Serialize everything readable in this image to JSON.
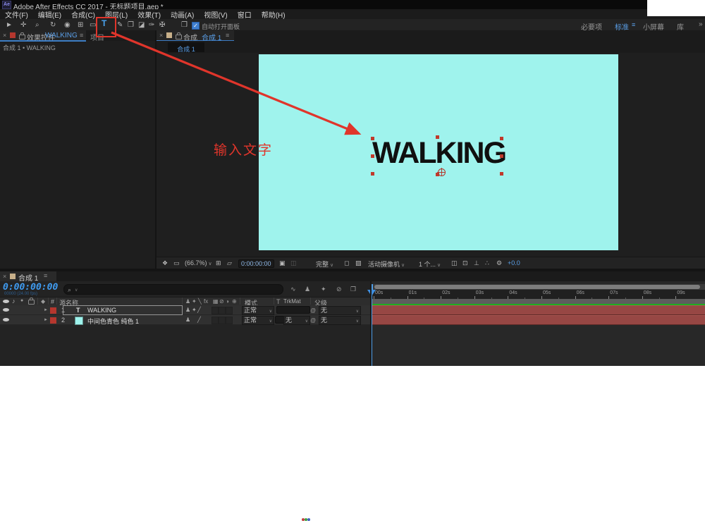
{
  "window": {
    "logo": "Ae",
    "title": "Adobe After Effects CC 2017 - 无标题项目.aep *"
  },
  "menu": {
    "items": [
      "文件(F)",
      "编辑(E)",
      "合成(C)",
      "图层(L)",
      "效果(T)",
      "动画(A)",
      "视图(V)",
      "窗口",
      "帮助(H)"
    ]
  },
  "toolbar": {
    "tools": [
      {
        "name": "selection-tool",
        "glyph": "►"
      },
      {
        "name": "hand-tool",
        "glyph": "✛"
      },
      {
        "name": "zoom-tool",
        "glyph": "⌕"
      },
      {
        "name": "rotation-tool",
        "glyph": "↻"
      },
      {
        "name": "camera-tool",
        "glyph": "◉"
      },
      {
        "name": "pan-behind-tool",
        "glyph": "⊞"
      },
      {
        "name": "shape-tool",
        "glyph": "▭"
      },
      {
        "name": "type-tool",
        "glyph": "T",
        "active": true
      },
      {
        "name": "brush-tool",
        "glyph": "✎"
      },
      {
        "name": "clone-stamp-tool",
        "glyph": "❐"
      },
      {
        "name": "eraser-tool",
        "glyph": "◪"
      },
      {
        "name": "roto-brush-tool",
        "glyph": "✑"
      },
      {
        "name": "puppet-pin-tool",
        "glyph": "✠"
      }
    ],
    "panel_button_icon": "❒",
    "auto_open_label": "自动打开面板",
    "workspaces": [
      {
        "label": "必要项",
        "active": false
      },
      {
        "label": "标准",
        "active": true
      },
      {
        "label": "小屏幕",
        "active": false
      },
      {
        "label": "库",
        "active": false
      }
    ],
    "overflow": "»"
  },
  "effect_controls_panel": {
    "tab_title": "效果控件",
    "tab_target": "WALKING",
    "neighbor_tab": "项目",
    "subtitle": "合成 1 • WALKING"
  },
  "comp_panel": {
    "tab_title": "合成",
    "tab_target": "合成 1",
    "viewer_tab": "合成 1",
    "canvas_text": "WALKING",
    "canvas_color": "#9ff3ed",
    "statusbar": {
      "zoom": "(66.7%)",
      "timecode": "0:00:00:00",
      "resolution": "完整",
      "camera": "活动摄像机",
      "views": "1 个...",
      "exposure": "+0.0"
    }
  },
  "annotations": {
    "hint_text": "输入文字",
    "color": "#e0352b"
  },
  "timeline_panel": {
    "tab": "合成 1",
    "timecode": "0:00:00:00",
    "frames_info": "00000 (24.00 fps)",
    "search_placeholder": "",
    "columns": {
      "source_name": "源名称",
      "hash": "#",
      "mode": "模式",
      "trkmat_t": "T",
      "trkmat": "TrkMat",
      "parent": "父级"
    },
    "switch_header_icons": [
      "♟",
      "✦",
      "╲",
      "fx",
      "▦",
      "⊘",
      "◑",
      "⊕"
    ],
    "search_row_icons": [
      "∿",
      "♟",
      "✦",
      "⊘",
      "❐"
    ],
    "layers": [
      {
        "num": "1",
        "type_icon": "T",
        "name": "WALKING",
        "mode": "正常",
        "trkmat": "",
        "parent": "无",
        "selected": true,
        "switches": [
          "♟",
          "✦",
          "╱"
        ],
        "label_color": "#b5372e"
      },
      {
        "num": "2",
        "type_icon": "solid-thumb",
        "name": "中间色青色 纯色 1",
        "mode": "正常",
        "trkmat": "无",
        "parent": "无",
        "selected": false,
        "switches": [
          "♟",
          "╱"
        ],
        "label_color": "#b5372e"
      }
    ],
    "ruler_labels": [
      "00s",
      "01s",
      "02s",
      "03s",
      "04s",
      "05s",
      "06s",
      "07s",
      "08s",
      "09s"
    ]
  },
  "icons": {
    "close": "×",
    "hamburger": "≡",
    "caret": "∨",
    "magnifier": "⌕",
    "overflow": "»",
    "check": "✓",
    "at": "@",
    "speaker": "♪",
    "solo_dot": "●",
    "label_tag": "◆",
    "twirl": "►",
    "sb_flowchart": "❖",
    "sb_monitor": "▭",
    "sb_grid": "⊞",
    "sb_roi": "▱",
    "sb_snapshot": "▣",
    "sb_show_snapshot": "◫",
    "sb_region": "◻",
    "sb_checker": "▨",
    "sb_layout": "◫",
    "sb_target": "⊡",
    "sb_pixelaspect": "⊥",
    "sb_miniflow": "∴",
    "sb_gear": "⚙"
  },
  "colors": {
    "accent_blue": "#5a9fe8",
    "timecode_blue": "#3f9bf0",
    "annotation_red": "#e0352b",
    "comp_cyan": "#9ff3ed",
    "cache_green": "#1fae1f",
    "layer_bar_red": "#974744",
    "label_swatch_red": "#b5372e",
    "comp_icon_tan": "#c8b08a"
  }
}
